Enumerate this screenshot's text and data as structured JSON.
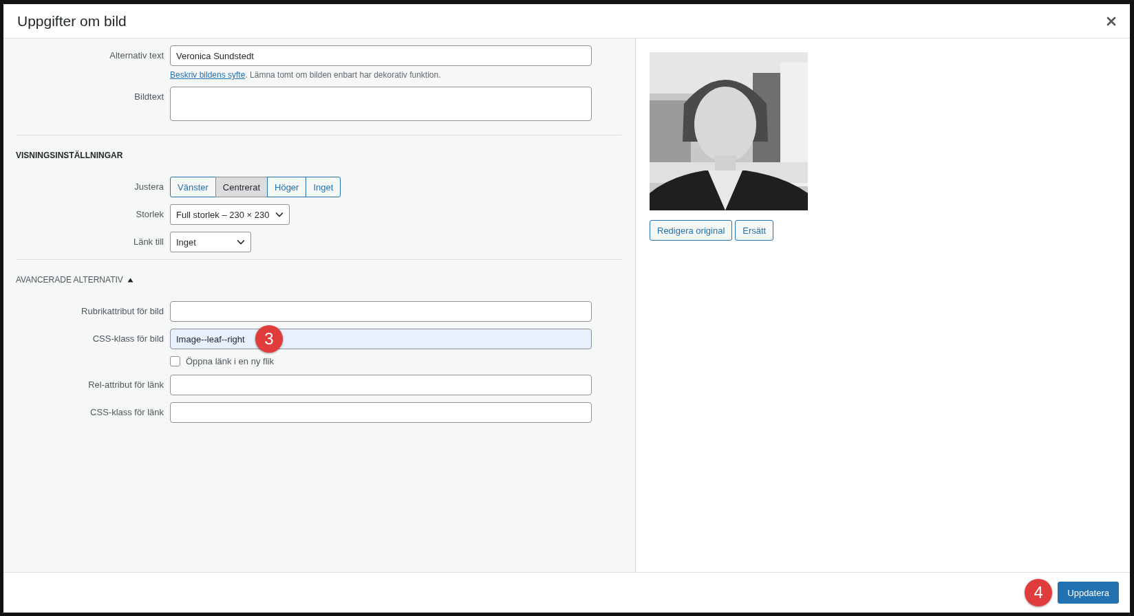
{
  "dialog": {
    "title": "Uppgifter om bild"
  },
  "attachment_fields": [
    {
      "kind": "input",
      "label": "Alternativ text",
      "value": "Veronica Sundstedt"
    },
    {
      "kind": "help",
      "link": "Beskriv bildens syfte",
      "text": ". Lämna tomt om bilden enbart har dekorativ funktion."
    },
    {
      "kind": "textarea",
      "label": "Bildtext"
    }
  ],
  "display_settings": {
    "heading": "VISNINGSINSTÄLLNINGAR",
    "align": {
      "label": "Justera",
      "options": [
        {
          "label": "Vänster",
          "selected": false
        },
        {
          "label": "Centrerat",
          "selected": true
        },
        {
          "label": "Höger",
          "selected": false
        },
        {
          "label": "Inget",
          "selected": false
        }
      ]
    },
    "size": {
      "label": "Storlek",
      "value": "Full storlek – 230 × 230"
    },
    "link_to": {
      "label": "Länk till",
      "value": "Inget"
    }
  },
  "advanced": {
    "heading": "AVANCERADE ALTERNATIV",
    "expanded": true,
    "fields": [
      {
        "kind": "input",
        "label": "Rubrikattribut för bild",
        "highlighted": false
      },
      {
        "kind": "input",
        "label": "CSS-klass för bild",
        "value": "Image--leaf--right",
        "highlighted": true,
        "marker": "3"
      },
      {
        "kind": "checkbox",
        "label": "Öppna länk i en ny flik",
        "checked": false
      },
      {
        "kind": "input",
        "label": "Rel-attribut för länk",
        "highlighted": false
      },
      {
        "kind": "input",
        "label": "CSS-klass för länk",
        "highlighted": false
      }
    ]
  },
  "preview": {
    "kind": "picture",
    "buttons": [
      "Redigera original",
      "Ersätt"
    ]
  },
  "footer": {
    "marker": "4",
    "button": "Uppdatera"
  }
}
